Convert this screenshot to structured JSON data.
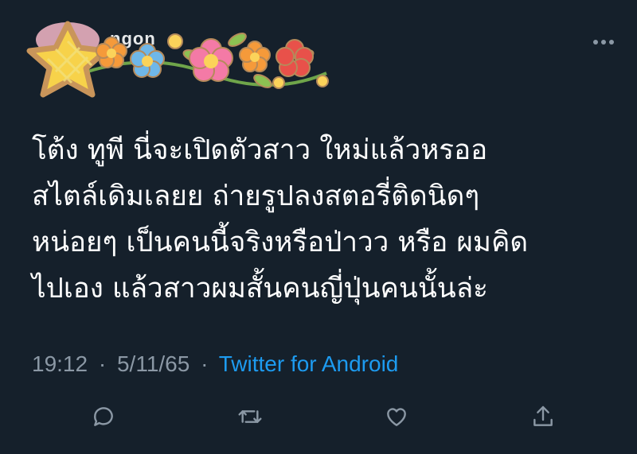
{
  "header": {
    "name_partial": "ngon",
    "more_icon": "more-horizontal-icon"
  },
  "tweet": {
    "lines": [
      "โต้ง ทูพี นี่จะเปิดตัวสาว ใหม่แล้วหรออ",
      "สไตล์เดิมเลยย ถ่ายรูปลงสตอรี่ติดนิดๆ",
      "หน่อยๆ เป็นคนนี้จริงหรือป่าวว หรือ ผมคิด",
      "ไปเอง แล้วสาวผมสั้นคนญี่ปุ่นคนนั้นล่ะ"
    ]
  },
  "meta": {
    "time": "19:12",
    "separator": "·",
    "date": "5/11/65",
    "source": "Twitter for Android"
  },
  "actions": {
    "reply_icon": "reply-icon",
    "retweet_icon": "retweet-icon",
    "like_icon": "heart-icon",
    "share_icon": "share-icon"
  },
  "colors": {
    "background": "#15202b",
    "text": "#ffffff",
    "muted": "#8b98a5",
    "link": "#1d9bf0"
  }
}
